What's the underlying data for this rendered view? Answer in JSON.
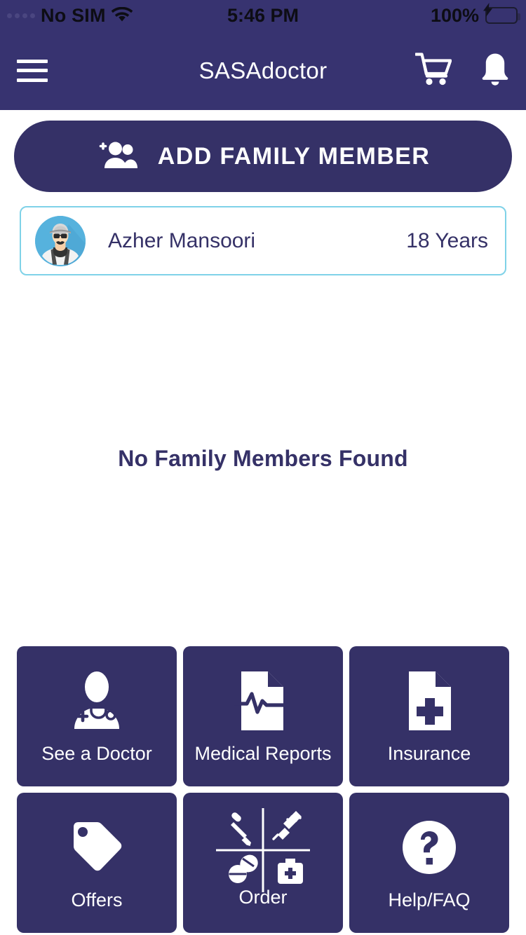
{
  "status_bar": {
    "carrier": "No SIM",
    "wifi_icon": "wifi-icon",
    "time": "5:46 PM",
    "battery_percent": "100%",
    "battery_icon": "battery-charging-icon"
  },
  "navbar": {
    "menu_icon": "hamburger-menu-icon",
    "title": "SASAdoctor",
    "cart_icon": "shopping-cart-icon",
    "bell_icon": "notification-bell-icon"
  },
  "add_family_member": {
    "label": "ADD FAMILY MEMBER",
    "icon": "add-person-icon"
  },
  "member_card": {
    "avatar_icon": "user-avatar-icon",
    "name": "Azher Mansoori",
    "age": "18 Years"
  },
  "empty_state": {
    "message": "No Family Members Found"
  },
  "tiles": [
    {
      "label": "See a Doctor",
      "icon": "doctor-stethoscope-icon"
    },
    {
      "label": "Medical Reports",
      "icon": "document-heartbeat-icon"
    },
    {
      "label": "Insurance",
      "icon": "document-cross-icon"
    },
    {
      "label": "Offers",
      "icon": "price-tag-icon"
    },
    {
      "label": "Order",
      "icon": "pharmacy-quadrant-icon"
    },
    {
      "label": "Help/FAQ",
      "icon": "question-circle-icon"
    }
  ],
  "colors": {
    "brand_navy": "#373370",
    "tile_navy": "#353167",
    "card_border_cyan": "#7fd2e8",
    "avatar_blue": "#56b2dd",
    "battery_green": "#5cdb63",
    "page_bg": "#ffffff"
  }
}
